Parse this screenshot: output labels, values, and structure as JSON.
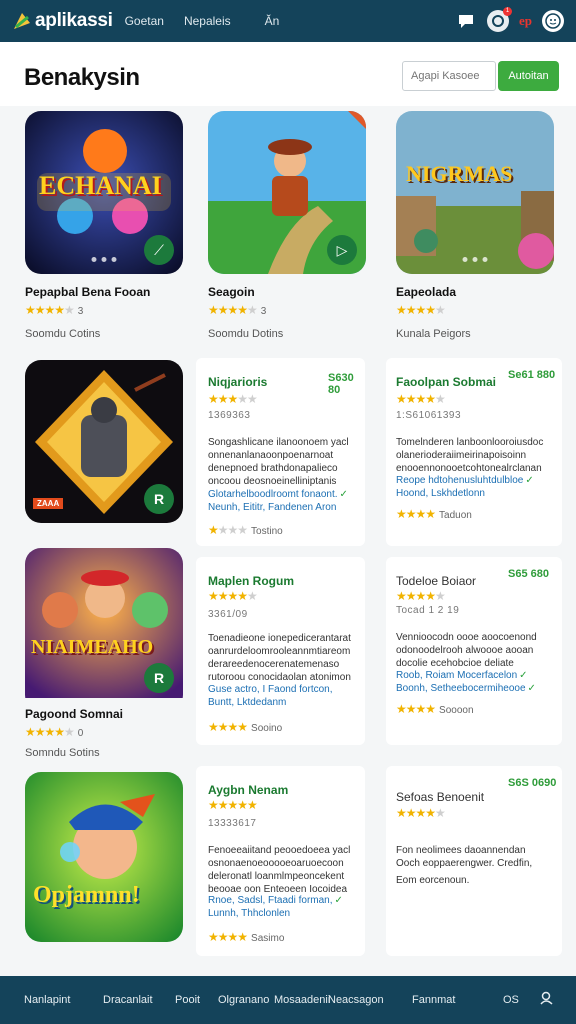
{
  "topbar": {
    "logo_text": "aplikassi",
    "nav": [
      "Goetan",
      "Nepaleis",
      "Ăn"
    ],
    "badge_count": "1",
    "ep_label": "ep"
  },
  "header": {
    "title": "Benakysin",
    "search_placeholder": "Agapi Kasoee",
    "search_button": "Autoitan"
  },
  "thumbs": [
    {
      "id": "t1",
      "title": "ECHANAI"
    },
    {
      "id": "t2",
      "title": ""
    },
    {
      "id": "t3",
      "title": "NIGRMAS"
    },
    {
      "id": "t4",
      "title": ""
    },
    {
      "id": "t5",
      "title": "NIAIMEAHO"
    },
    {
      "id": "t6",
      "title": "Opjamnn!"
    }
  ],
  "tile_labels": [
    {
      "name": "Pepapbal Bena Fooan",
      "rating": 4,
      "count": "3",
      "meta": "Soomdu  Cotins"
    },
    {
      "name": "Seagoin",
      "rating": 4,
      "count": "3",
      "meta": "Soomdu  Dotins"
    },
    {
      "name": "Eapeolada",
      "rating": 4,
      "count": "",
      "meta": "Kunala  Peigors"
    },
    {
      "name": "Pagoond Somnai",
      "rating": 4,
      "count": "0",
      "meta": "Somndu  Sotins"
    }
  ],
  "badge_label": "ZAAA",
  "cards": [
    {
      "title": "Niqjarioris",
      "price": "S630 80",
      "sub": "1369363",
      "rating": 3,
      "desc": [
        "Songashlicane ilanoonoem yacl",
        "onnenanlanaoonpoenarnoat",
        "denepnoed brathdonapalieco",
        "oncoou deosnoeinelliniptanis"
      ],
      "link": [
        "Glotarhelboodlroomt fonaont.",
        "Neunh, Eititr, Fandenen Aron"
      ],
      "foot_rating": 2,
      "foot": "Tostino"
    },
    {
      "title": "Faoolpan Sobmai",
      "price": "Se61 880",
      "sub": "1:S61061393",
      "rating": 4,
      "desc": [
        "Tomelnderen lanboonlooroiusdoc",
        "olanerioderaiimeirinapoisoinn",
        "enooennonooetcohtonealrclanan"
      ],
      "link": [
        "Reope hdtohenusluhtdulbloe",
        "Hoond, Lskhdetlonn"
      ],
      "foot_rating": 4,
      "foot": "Taduon"
    },
    {
      "title": "Maplen Rogum",
      "price": "",
      "sub": "3361/09",
      "rating": 4,
      "desc": [
        "Toenadieone ionepedicerantarat",
        "oanrurdeloomrooleannmtiareom",
        "derareedenocerenatemenaso",
        "rutoroou conocidaolan atonimon"
      ],
      "link": [
        "Guse actro, I Faond fortcon,",
        "Buntt, Lktdedanm"
      ],
      "foot_rating": 4,
      "foot": "Sooino"
    },
    {
      "title": "Todeloe Boiaor",
      "price": "S65 680",
      "sub": "Tocad 1 2 19",
      "rating": 4,
      "desc": [
        "Vennioocodn oooe aoocoenond",
        "odonoodelrooh alwoooe aooan",
        "docolie ecehobcioe deliate"
      ],
      "link": [
        "Roob, Roiam Mocerfacelon",
        "Boonh, Setheebocermiheooe"
      ],
      "foot_rating": 4,
      "foot": "Soooon"
    },
    {
      "title": "Aygbn Nenam",
      "price": "",
      "sub": "13333617",
      "rating": 5,
      "desc": [
        "Fenoeeaiitand peooedoeea yacl",
        "osnonaenoeooooeoaruoecoon",
        "deleronatl loanmlmpeoncekent",
        "beooae oon Enteoeen Iocoidea"
      ],
      "link": [
        "Rnoe, Sadsl, Ftaadi forman,",
        "Lunnh, Thhclonlen"
      ],
      "foot_rating": 4,
      "foot": "Sasimo"
    },
    {
      "title": "Sefoas Benoenit",
      "price": "S6S 0690",
      "sub": "",
      "rating": 4,
      "desc": [
        "Fon neolimees daoannendan",
        "Ooch eoppaerengwer. Credfin,",
        "Eom eorcenoun."
      ],
      "link": [],
      "foot_rating": 0,
      "foot": ""
    }
  ],
  "bottombar": {
    "items": [
      "Nanlapint",
      "Dracanlait",
      "Pooit",
      "Olgranano",
      "Mosaadenii",
      "Neacsagon",
      "Fannmat",
      "OS"
    ]
  },
  "colors": {
    "primary": "#14435a",
    "accent": "#3dab3f",
    "star": "#f1b300",
    "link": "#1c6fb3"
  }
}
